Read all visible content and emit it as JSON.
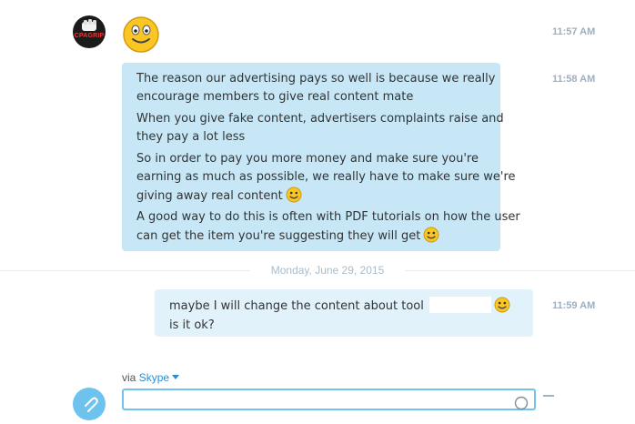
{
  "conversation": {
    "avatar_text": "CPAGRIP",
    "messages_in": {
      "time_emoji": "11:57 AM",
      "time_text": "11:58 AM",
      "lines": [
        "The reason our advertising pays so well is because we really",
        "encourage members to give real content mate",
        "When you give fake content, advertisers complaints raise and",
        "they pay a lot less",
        "So in order to pay you more money and make sure you're",
        "earning as much as possible, we really have to make sure we're",
        "giving away real content",
        "A good way to do this is often with PDF tutorials on how the user",
        "can get the item you're suggesting they will get"
      ]
    },
    "date_separator": "Monday, June 29, 2015",
    "messages_out": {
      "time": "11:59 AM",
      "lines": [
        "maybe I will change the content about tool",
        "is it ok?"
      ]
    }
  },
  "compose": {
    "via_label": "via",
    "via_service": "Skype"
  },
  "colors": {
    "bubble_in": "#c7e7f7",
    "bubble_out": "#e1f2fb",
    "timestamp": "#9dafc0",
    "accent": "#2a8ed6"
  }
}
